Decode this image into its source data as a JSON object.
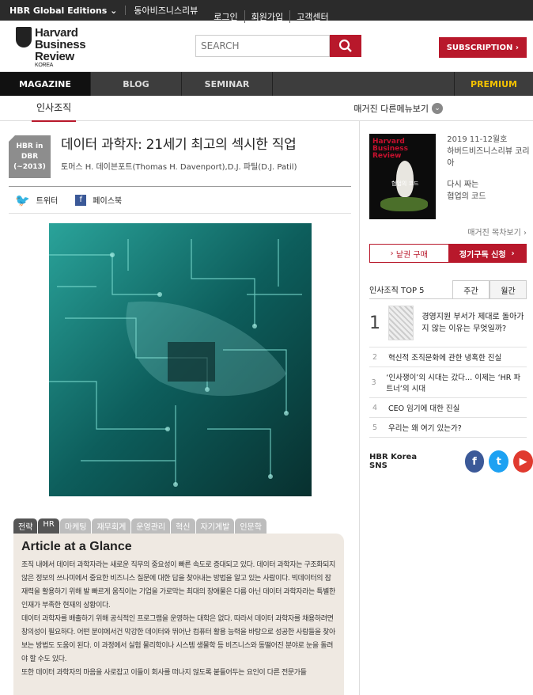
{
  "topbar": {
    "edition": "HBR Global Editions",
    "partner": "동아비즈니스리뷰",
    "links": [
      "로그인",
      "회원가입",
      "고객센터"
    ]
  },
  "logo": {
    "line1": "Harvard",
    "line2": "Business",
    "line3": "Review",
    "sub": "KOREA"
  },
  "search": {
    "placeholder": "SEARCH"
  },
  "subscription_label": "SUBSCRIPTION",
  "nav": {
    "items": [
      "MAGAZINE",
      "BLOG",
      "SEMINAR"
    ],
    "premium": "PREMIUM"
  },
  "subnav": {
    "category": "인사조직",
    "more": "매거진 다른메뉴보기"
  },
  "article": {
    "tag_line1": "HBR in DBR",
    "tag_line2": "(~2013)",
    "title": "데이터 과학자: 21세기 최고의 섹시한 직업",
    "authors": "토머스 H. 데이븐포트(Thomas H. Davenport),D.J. 파틸(D.J. Patil)",
    "share_twitter": "트위터",
    "share_facebook": "페이스북"
  },
  "glance": {
    "tabs": [
      "전략",
      "HR",
      "마케팅",
      "재무회계",
      "운영관리",
      "혁신",
      "자기계발",
      "인문학"
    ],
    "heading": "Article at a Glance",
    "paragraphs": [
      "조직 내에서 데이터 과학자라는 새로운 직무의 중요성이 빠른 속도로 증대되고 있다. 데이터 과학자는 구조화되지 않은 정보의 쓰나미에서 중요한 비즈니스 질문에 대한 답을 찾아내는 방법을 알고 있는 사람이다. 빅데이터의 잠재력을 활용하기 위해 발 빠르게 움직이는 기업을 가로막는 최대의 장애물은 다름 아닌 데이터 과학자라는 특별한 인재가 부족한 현재의 상황이다.",
      "데이터 과학자를 배출하기 위해 공식적인 프로그램을 운영하는 대학은 없다. 따라서 데이터 과학자를 채용하려면 창의성이 필요하다. 어떤 분야에서건 막강한 데이터와 뛰어난 컴퓨터 활용 능력을 바탕으로 성공한 사람들을 찾아보는 방법도 도움이 된다. 이 과정에서 실험 물리학이나 시스템 생물학 등 비즈니스와 동떨어진 분야로 눈을 돌려야 할 수도 있다.",
      "또한 데이터 과학자의 마음을 사로잡고 이들이 회사를 떠나지 않도록 붙들어두는 요인이 다른 전문가들"
    ]
  },
  "magazine": {
    "cover_title": "Harvard Business Review",
    "cover_label": "협업의 코드",
    "issue": "2019 11-12월호",
    "name": "하버드비즈니스리뷰 코리아",
    "tagline1": "다시 짜는",
    "tagline2": "협업의 코드",
    "contents_link": "매거진 목차보기",
    "buy_single": "낱권 구매",
    "buy_subscribe": "정기구독 신청"
  },
  "top5": {
    "title": "인사조직 TOP 5",
    "tabs": [
      "주간",
      "월간"
    ],
    "items": [
      {
        "num": "1",
        "text": "경영지원 부서가 제대로 돌아가지 않는 이유는 무엇일까?"
      },
      {
        "num": "2",
        "text": "혁신적 조직문화에 관한 냉혹한 진실"
      },
      {
        "num": "3",
        "text": "‘인사쟁이’의 시대는 갔다… 이제는 ‘HR 파트너’의 시대"
      },
      {
        "num": "4",
        "text": "CEO 임기에 대한 진실"
      },
      {
        "num": "5",
        "text": "우리는 왜 여기 있는가?"
      }
    ]
  },
  "sns": {
    "label": "HBR Korea SNS",
    "icons": [
      "facebook-icon",
      "twitter-icon",
      "youtube-icon"
    ],
    "colors": [
      "#3b5998",
      "#1da1f2",
      "#e03a2f"
    ]
  }
}
